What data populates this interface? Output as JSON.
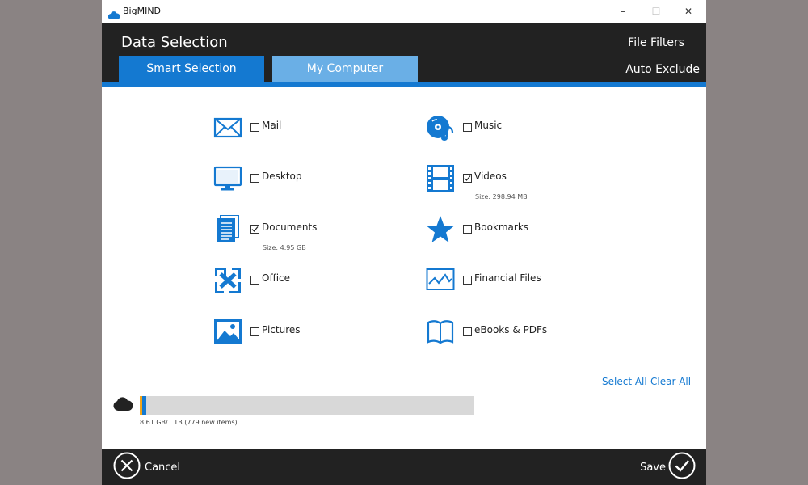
{
  "app": {
    "title": "BigMIND"
  },
  "window_controls": {
    "minimize": "–",
    "maximize": "☐",
    "close": "✕"
  },
  "header": {
    "title": "Data Selection",
    "file_filters": "File Filters",
    "auto_exclude": "Auto Exclude",
    "tabs": [
      {
        "label": "Smart Selection",
        "active": true
      },
      {
        "label": "My Computer",
        "active": false
      }
    ]
  },
  "categories": [
    {
      "label": "Mail",
      "checked": false,
      "icon": "mail-icon"
    },
    {
      "label": "Desktop",
      "checked": false,
      "icon": "desktop-icon"
    },
    {
      "label": "Documents",
      "checked": true,
      "icon": "documents-icon",
      "size": "Size: 4.95 GB"
    },
    {
      "label": "Office",
      "checked": false,
      "icon": "office-icon"
    },
    {
      "label": "Pictures",
      "checked": false,
      "icon": "pictures-icon"
    },
    {
      "label": "Music",
      "checked": false,
      "icon": "music-icon"
    },
    {
      "label": "Videos",
      "checked": true,
      "icon": "videos-icon",
      "size": "Size: 298.94 MB"
    },
    {
      "label": "Bookmarks",
      "checked": false,
      "icon": "bookmarks-icon"
    },
    {
      "label": "Financial Files",
      "checked": false,
      "icon": "financial-icon"
    },
    {
      "label": "eBooks & PDFs",
      "checked": false,
      "icon": "ebooks-icon"
    }
  ],
  "actions": {
    "select_all": "Select All",
    "clear_all": "Clear All"
  },
  "storage": {
    "usage_text": "8.61 GB/1 TB (779 new items)",
    "used_fraction": 0.0086,
    "segment_colors": [
      "#f2a51a",
      "#1479d1"
    ]
  },
  "footer": {
    "cancel": "Cancel",
    "save": "Save"
  },
  "colors": {
    "accent": "#1479d1",
    "dark": "#222222",
    "tab_inactive": "#6aafe6"
  }
}
